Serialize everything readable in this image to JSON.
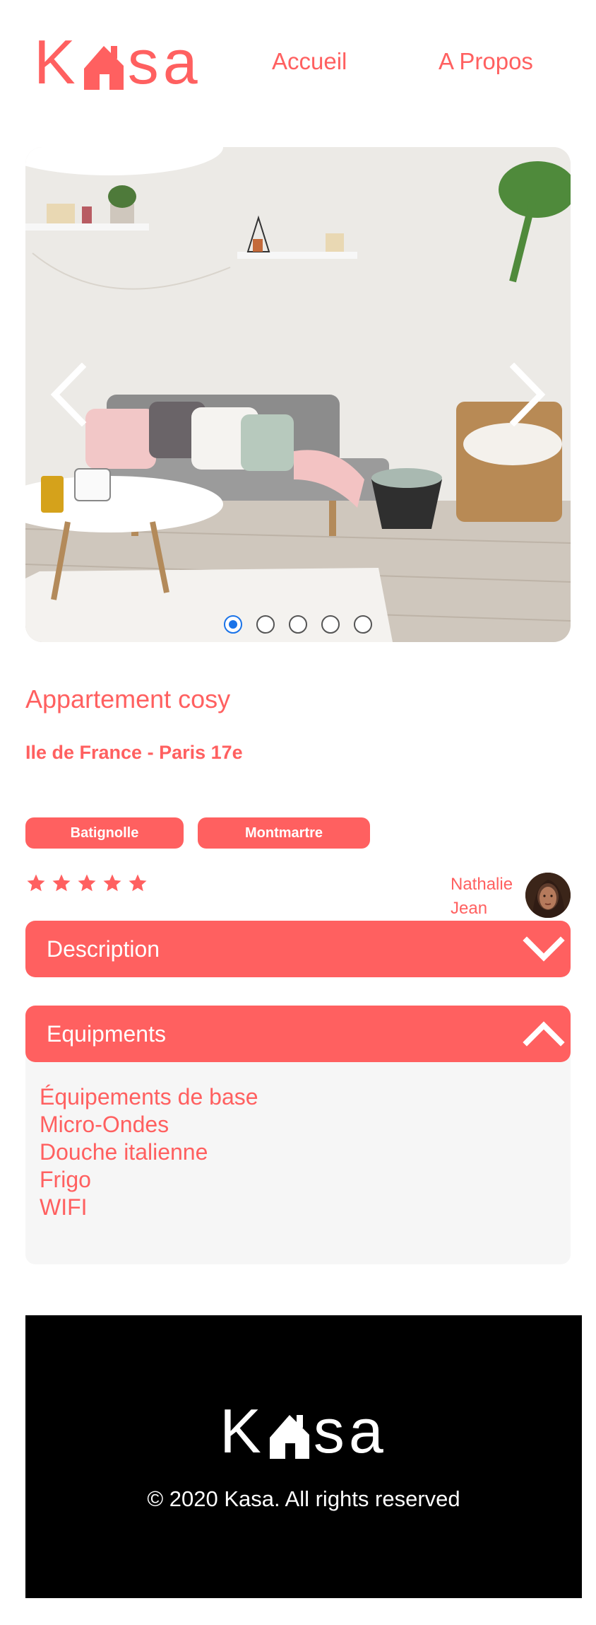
{
  "header": {
    "logo_left": "K",
    "logo_right": "sa",
    "nav": {
      "home": "Accueil",
      "about": "A Propos"
    }
  },
  "carousel": {
    "slide_count": 5,
    "active_index": 0,
    "icons": {
      "prev": "chevron-left-icon",
      "next": "chevron-right-icon"
    }
  },
  "listing": {
    "title": "Appartement cosy",
    "location": "Ile de France - Paris 17e",
    "tags": [
      "Batignolle",
      "Montmartre"
    ],
    "rating": 5,
    "rating_max": 5,
    "host": {
      "first_name": "Nathalie",
      "last_name": "Jean"
    }
  },
  "description": {
    "label": "Description",
    "expanded": false
  },
  "equipments": {
    "label": "Equipments",
    "expanded": true,
    "items": [
      "Équipements de base",
      "Micro-Ondes",
      "Douche italienne",
      "Frigo",
      "WIFI"
    ]
  },
  "footer": {
    "logo_left": "K",
    "logo_right": "sa",
    "copyright": "© 2020 Kasa. All rights reserved"
  },
  "colors": {
    "primary": "#FF6060",
    "panel": "#F6F6F6",
    "footer_bg": "#000000",
    "dot_active": "#1A73E8"
  }
}
